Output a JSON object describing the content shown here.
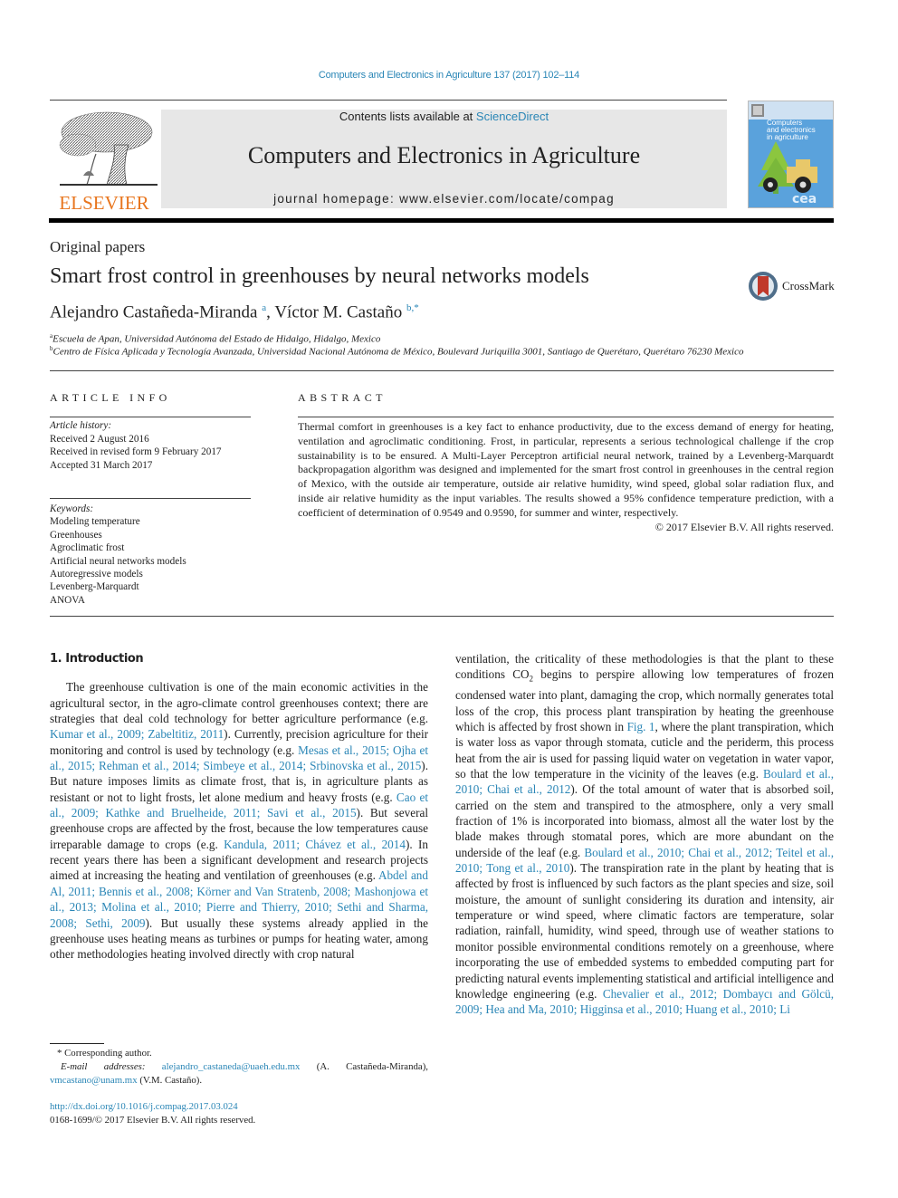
{
  "header": {
    "journal_reference": "Computers and Electronics in Agriculture 137 (2017) 102–114",
    "contents_prefix": "Contents lists available at ",
    "contents_link": "ScienceDirect",
    "journal_title": "Computers and Electronics in Agriculture",
    "homepage_prefix": "journal homepage: ",
    "homepage_url": "www.elsevier.com/locate/compag",
    "publisher_logo_text": "ELSEVIER",
    "cover_title_lines": [
      "Computers",
      "and electronics",
      "in agriculture"
    ],
    "cover_logo_text": "cea",
    "colors": {
      "link": "#2a86b6",
      "elsevier_orange": "#e8761f",
      "banner_gray": "#e7e7e7",
      "cover_blue": "#5aa2dc"
    }
  },
  "article": {
    "type": "Original papers",
    "title": "Smart frost control in greenhouses by neural networks models",
    "crossmark_label": "CrossMark",
    "authors": [
      {
        "name": "Alejandro Castañeda-Miranda",
        "sup": "a"
      },
      {
        "name": "Víctor M. Castaño",
        "sup": "b,*"
      }
    ],
    "affiliations": [
      {
        "key": "a",
        "text": "Escuela de Apan, Universidad Autónoma del Estado de Hidalgo, Hidalgo, Mexico"
      },
      {
        "key": "b",
        "text": "Centro de Física Aplicada y Tecnología Avanzada, Universidad Nacional Autónoma de México, Boulevard Juriquilla 3001, Santiago de Querétaro, Querétaro 76230 Mexico"
      }
    ]
  },
  "article_info": {
    "heading": "ARTICLE INFO",
    "history_label": "Article history:",
    "history": [
      "Received 2 August 2016",
      "Received in revised form 9 February 2017",
      "Accepted 31 March 2017"
    ],
    "keywords_label": "Keywords:",
    "keywords": [
      "Modeling temperature",
      "Greenhouses",
      "Agroclimatic frost",
      "Artificial neural networks models",
      "Autoregressive models",
      "Levenberg-Marquardt",
      "ANOVA"
    ]
  },
  "abstract": {
    "heading": "ABSTRACT",
    "text": "Thermal comfort in greenhouses is a key fact to enhance productivity, due to the excess demand of energy for heating, ventilation and agroclimatic conditioning. Frost, in particular, represents a serious technological challenge if the crop sustainability is to be ensured. A Multi-Layer Perceptron artificial neural network, trained by a Levenberg-Marquardt backpropagation algorithm was designed and implemented for the smart frost control in greenhouses in the central region of Mexico, with the outside air temperature, outside air relative humidity, wind speed, global solar radiation flux, and inside air relative humidity as the input variables. The results showed a 95% confidence temperature prediction, with a coefficient of determination of 0.9549 and 0.9590, for summer and winter, respectively.",
    "copyright": "© 2017 Elsevier B.V. All rights reserved."
  },
  "body": {
    "section_heading": "1. Introduction",
    "left_column": [
      {
        "t": "The greenhouse cultivation is one of the main economic activities in the agricultural sector, in the agro-climate control greenhouses context; there are strategies that deal cold technology for better agriculture performance (e.g. "
      },
      {
        "l": "Kumar et al., 2009; Zabeltitiz, 2011"
      },
      {
        "t": "). Currently, precision agriculture for their monitoring and control is used by technology (e.g. "
      },
      {
        "l": "Mesas et al., 2015; Ojha et al., 2015; Rehman et al., 2014; Simbeye et al., 2014; Srbinovska et al., 2015"
      },
      {
        "t": "). But nature imposes limits as climate frost, that is, in agriculture plants as resistant or not to light frosts, let alone medium and heavy frosts (e.g. "
      },
      {
        "l": "Cao et al., 2009; Kathke and Bruelheide, 2011; Savi et al., 2015"
      },
      {
        "t": "). But several greenhouse crops are affected by the frost, because the low temperatures cause irreparable damage to crops (e.g. "
      },
      {
        "l": "Kandula, 2011; Chávez et al., 2014"
      },
      {
        "t": "). In recent years there has been a significant development and research projects aimed at increasing the heating and ventilation of greenhouses (e.g. "
      },
      {
        "l": "Abdel and Al, 2011; Bennis et al., 2008; Körner and Van Stratenb, 2008; Mashonjowa et al., 2013; Molina et al., 2010; Pierre and Thierry, 2010; Sethi and Sharma, 2008; Sethi, 2009"
      },
      {
        "t": "). But usually these systems already applied in the greenhouse uses heating means as turbines or pumps for heating water, among other methodologies heating involved directly with crop natural"
      }
    ],
    "right_column": [
      {
        "t": "ventilation, the criticality of these methodologies is that the plant to these conditions CO"
      },
      {
        "sub": "2"
      },
      {
        "t": " begins to perspire allowing low temperatures of frozen condensed water into plant, damaging the crop, which normally generates total loss of the crop, this process plant transpiration by heating the greenhouse which is affected by frost shown in "
      },
      {
        "l": "Fig. 1"
      },
      {
        "t": ", where the plant transpiration, which is water loss as vapor through stomata, cuticle and the periderm, this process heat from the air is used for passing liquid water on vegetation in water vapor, so that the low temperature in the vicinity of the leaves (e.g. "
      },
      {
        "l": "Boulard et al., 2010; Chai et al., 2012"
      },
      {
        "t": "). Of the total amount of water that is absorbed soil, carried on the stem and transpired to the atmosphere, only a very small fraction of 1% is incorporated into biomass, almost all the water lost by the blade makes through stomatal pores, which are more abundant on the underside of the leaf (e.g. "
      },
      {
        "l": "Boulard et al., 2010; Chai et al., 2012; Teitel et al., 2010; Tong et al., 2010"
      },
      {
        "t": "). The transpiration rate in the plant by heating that is affected by frost is influenced by such factors as the plant species and size, soil moisture, the amount of sunlight considering its duration and intensity, air temperature or wind speed, where climatic factors are temperature, solar radiation, rainfall, humidity, wind speed, through use of weather stations to monitor possible environmental conditions remotely on a greenhouse, where incorporating the use of embedded systems to embedded computing part for predicting natural events implementing statistical and artificial intelligence and knowledge engineering (e.g. "
      },
      {
        "l": "Chevalier et al., 2012; Dombaycı and Gölcü, 2009; Hea and Ma, 2010; Higginsa et al., 2010; Huang et al., 2010; Li"
      }
    ]
  },
  "footnotes": {
    "corresponding_mark": "*",
    "corresponding_text": "Corresponding author.",
    "email_label": "E-mail addresses:",
    "emails": [
      {
        "address": "alejandro_castaneda@uaeh.edu.mx",
        "owner": "(A. Castañeda-Miranda),"
      },
      {
        "address": "vmcastano@unam.mx",
        "owner": "(V.M. Castaño)."
      }
    ],
    "doi": "http://dx.doi.org/10.1016/j.compag.2017.03.024",
    "issn_line": "0168-1699/© 2017 Elsevier B.V. All rights reserved."
  }
}
